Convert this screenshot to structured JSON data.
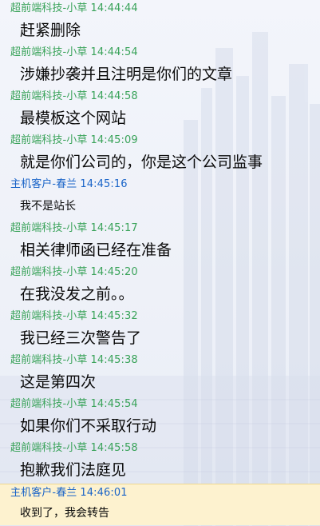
{
  "colors": {
    "agent_sender": "#3aa35a",
    "customer_sender": "#1a64c8",
    "message_text": "#0a0a0a",
    "highlight_bg": "#fdf2cf"
  },
  "messages": [
    {
      "sender": "超前端科技-小草",
      "time": "14:44:44",
      "text": "赶紧删除",
      "role": "agent"
    },
    {
      "sender": "超前端科技-小草",
      "time": "14:44:54",
      "text": "涉嫌抄袭并且注明是你们的文章",
      "role": "agent"
    },
    {
      "sender": "超前端科技-小草",
      "time": "14:44:58",
      "text": "最模板这个网站",
      "role": "agent"
    },
    {
      "sender": "超前端科技-小草",
      "time": "14:45:09",
      "text": "就是你们公司的，你是这个公司监事",
      "role": "agent"
    },
    {
      "sender": "主机客户-春兰",
      "time": "14:45:16",
      "text": "我不是站长",
      "role": "customer"
    },
    {
      "sender": "超前端科技-小草",
      "time": "14:45:17",
      "text": "相关律师函已经在准备",
      "role": "agent"
    },
    {
      "sender": "超前端科技-小草",
      "time": "14:45:20",
      "text": "在我没发之前。。",
      "role": "agent"
    },
    {
      "sender": "超前端科技-小草",
      "time": "14:45:32",
      "text": "我已经三次警告了",
      "role": "agent"
    },
    {
      "sender": "超前端科技-小草",
      "time": "14:45:38",
      "text": "这是第四次",
      "role": "agent"
    },
    {
      "sender": "超前端科技-小草",
      "time": "14:45:54",
      "text": "如果你们不采取行动",
      "role": "agent"
    },
    {
      "sender": "超前端科技-小草",
      "time": "14:45:58",
      "text": "抱歉我们法庭见",
      "role": "agent"
    },
    {
      "sender": "主机客户-春兰",
      "time": "14:46:01",
      "text": "收到了，我会转告",
      "role": "customer"
    }
  ]
}
